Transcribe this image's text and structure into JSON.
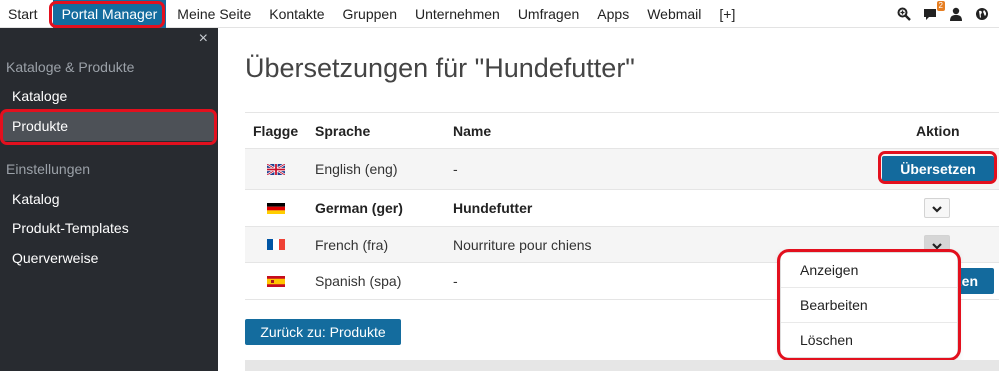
{
  "topnav": {
    "items": [
      {
        "label": "Start",
        "active": false
      },
      {
        "label": "Portal Manager",
        "active": true
      },
      {
        "label": "Meine Seite",
        "active": false
      },
      {
        "label": "Kontakte",
        "active": false
      },
      {
        "label": "Gruppen",
        "active": false
      },
      {
        "label": "Unternehmen",
        "active": false
      },
      {
        "label": "Umfragen",
        "active": false
      },
      {
        "label": "Apps",
        "active": false
      },
      {
        "label": "Webmail",
        "active": false
      },
      {
        "label": "[+]",
        "active": false
      }
    ],
    "icons": [
      "zoom-icon",
      "chat-icon",
      "user-icon",
      "globe-icon"
    ],
    "chat_badge": "2"
  },
  "sidebar": {
    "close_glyph": "×",
    "section1": "Kataloge & Produkte",
    "section1_items": [
      "Kataloge",
      "Produkte"
    ],
    "selected_item": "Produkte",
    "section2": "Einstellungen",
    "section2_items": [
      "Katalog",
      "Produkt-Templates",
      "Querverweise"
    ]
  },
  "main": {
    "title": "Übersetzungen für \"Hundefutter\"",
    "table": {
      "headers": {
        "flag": "Flagge",
        "language": "Sprache",
        "name": "Name",
        "action": "Aktion"
      },
      "rows": [
        {
          "flag": "uk",
          "language": "English (eng)",
          "name": "-",
          "action": "Übersetzen",
          "bold": false
        },
        {
          "flag": "de",
          "language": "German (ger)",
          "name": "Hundefutter",
          "action": "menu",
          "bold": true
        },
        {
          "flag": "fr",
          "language": "French (fra)",
          "name": "Nourriture pour chiens",
          "action": "menu-open",
          "bold": false
        },
        {
          "flag": "es",
          "language": "Spanish (spa)",
          "name": "-",
          "action": "Übersetzen",
          "action_visible": "zen",
          "bold": false
        }
      ]
    },
    "dropdown": [
      "Anzeigen",
      "Bearbeiten",
      "Löschen"
    ],
    "back_button": "Zurück zu: Produkte"
  },
  "colors": {
    "accent": "#146c9e",
    "highlight_ring": "#e3101e",
    "sidebar_bg": "#282b30",
    "sidebar_selected": "#4d5157",
    "badge": "#e67e22"
  }
}
